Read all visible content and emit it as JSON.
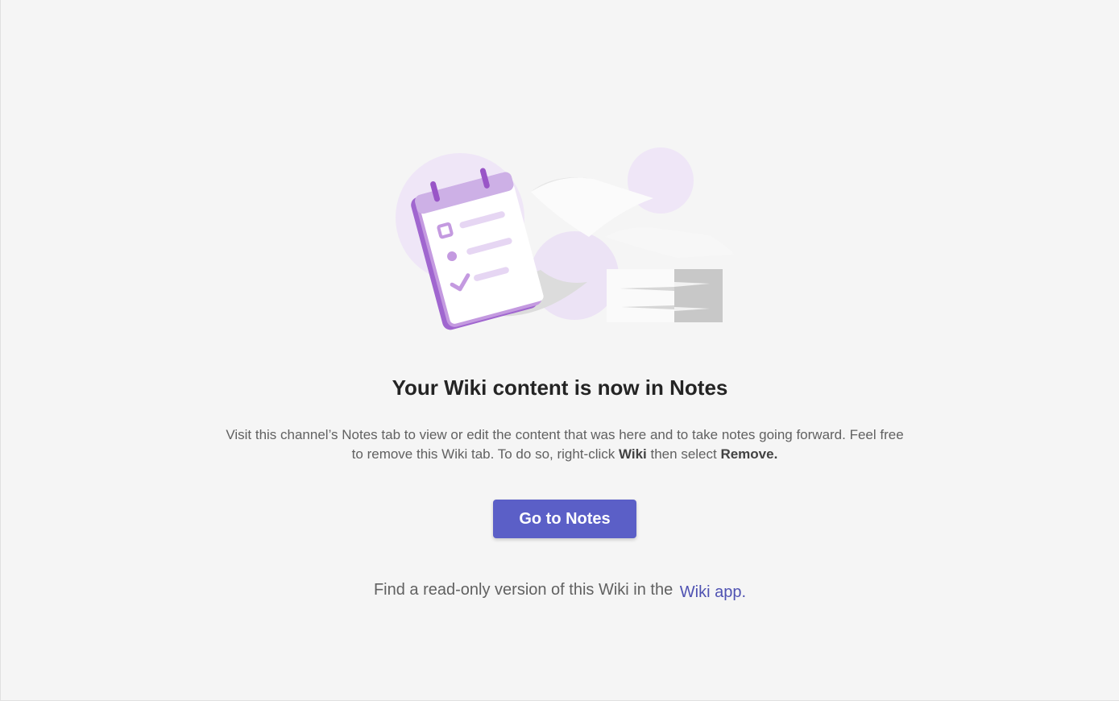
{
  "illustration": {
    "icon": "notes-checklist-illustration"
  },
  "heading": "Your Wiki content is now in Notes",
  "description": {
    "line1": "Visit this channel’s Notes tab to view or edit the content that was here and to take notes going forward. Feel free",
    "line2_prefix": "to remove this Wiki tab. To do so, right-click ",
    "wiki_bold": "Wiki",
    "line2_mid": " then select ",
    "remove_bold": "Remove."
  },
  "button": {
    "label": "Go to Notes"
  },
  "footer": {
    "text": "Find a read-only version of this Wiki in the",
    "link_text": "Wiki app."
  },
  "colors": {
    "background": "#f5f5f5",
    "accent": "#5b5fc7",
    "link": "#4f52b2",
    "heading": "#242424",
    "body_text": "#616161"
  }
}
